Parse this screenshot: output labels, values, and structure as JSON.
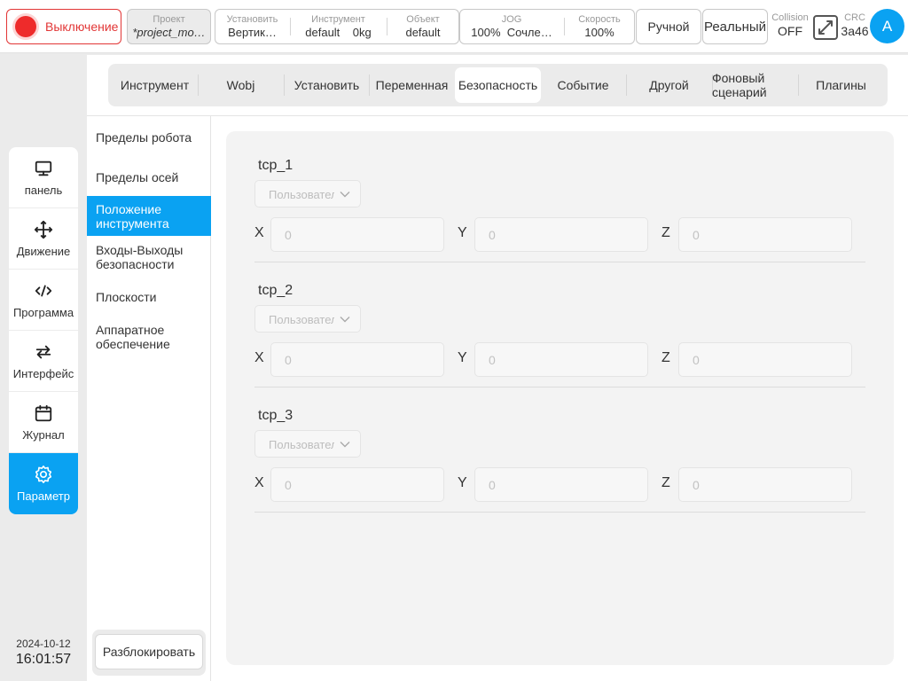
{
  "topbar": {
    "power_label": "Выключение",
    "project": {
      "caption": "Проект",
      "value": "*project_mo…"
    },
    "install": {
      "caption": "Установить",
      "value": "Вертик…"
    },
    "tool": {
      "caption": "Инструмент",
      "value": "default",
      "load": "0kg"
    },
    "object": {
      "caption": "Объект",
      "value": "default"
    },
    "jog": {
      "caption": "JOG",
      "percent": "100%",
      "mode": "Сочле…"
    },
    "speed": {
      "caption": "Скорость",
      "value": "100%"
    },
    "manual_label": "Ручной",
    "real_label": "Реальный",
    "collision": {
      "caption": "Collision",
      "value": "OFF"
    },
    "crc": {
      "caption": "CRC",
      "value": "3a46"
    },
    "avatar_letter": "A",
    "icons": {
      "power": "power-indicator",
      "expand": "expand-icon"
    },
    "colors": {
      "power": "#ee2b2b",
      "accent": "#0aa2f2"
    }
  },
  "leftnav": {
    "items": [
      {
        "label": "панель",
        "icon": "monitor-icon"
      },
      {
        "label": "Движение",
        "icon": "move-arrows-icon"
      },
      {
        "label": "Программа",
        "icon": "code-icon"
      },
      {
        "label": "Интерфейс",
        "icon": "swap-arrows-icon"
      },
      {
        "label": "Журнал",
        "icon": "calendar-icon"
      },
      {
        "label": "Параметр",
        "icon": "gear-icon",
        "active": true
      }
    ]
  },
  "datetime": {
    "date": "2024-10-12",
    "time": "16:01:57"
  },
  "tabs": [
    {
      "label": "Инструмент"
    },
    {
      "label": "Wobj"
    },
    {
      "label": "Установить"
    },
    {
      "label": "Переменная"
    },
    {
      "label": "Безопасность",
      "active": true
    },
    {
      "label": "Событие"
    },
    {
      "label": "Другой"
    },
    {
      "label": "Фоновый сценарий"
    },
    {
      "label": "Плагины"
    }
  ],
  "subnav": {
    "items": [
      {
        "label": "Пределы робота"
      },
      {
        "label": "Пределы осей"
      },
      {
        "label": "Положение инструмента",
        "active": true
      },
      {
        "label": "Входы-Выходы безопасности"
      },
      {
        "label": "Плоскости"
      },
      {
        "label": "Аппаратное обеспечение"
      }
    ],
    "unlock_label": "Разблокировать"
  },
  "tcp": {
    "select_placeholder": "Пользователь",
    "axes": {
      "x": "X",
      "y": "Y",
      "z": "Z"
    },
    "items": [
      {
        "title": "tcp_1",
        "x": "0",
        "y": "0",
        "z": "0"
      },
      {
        "title": "tcp_2",
        "x": "0",
        "y": "0",
        "z": "0"
      },
      {
        "title": "tcp_3",
        "x": "0",
        "y": "0",
        "z": "0"
      }
    ]
  }
}
